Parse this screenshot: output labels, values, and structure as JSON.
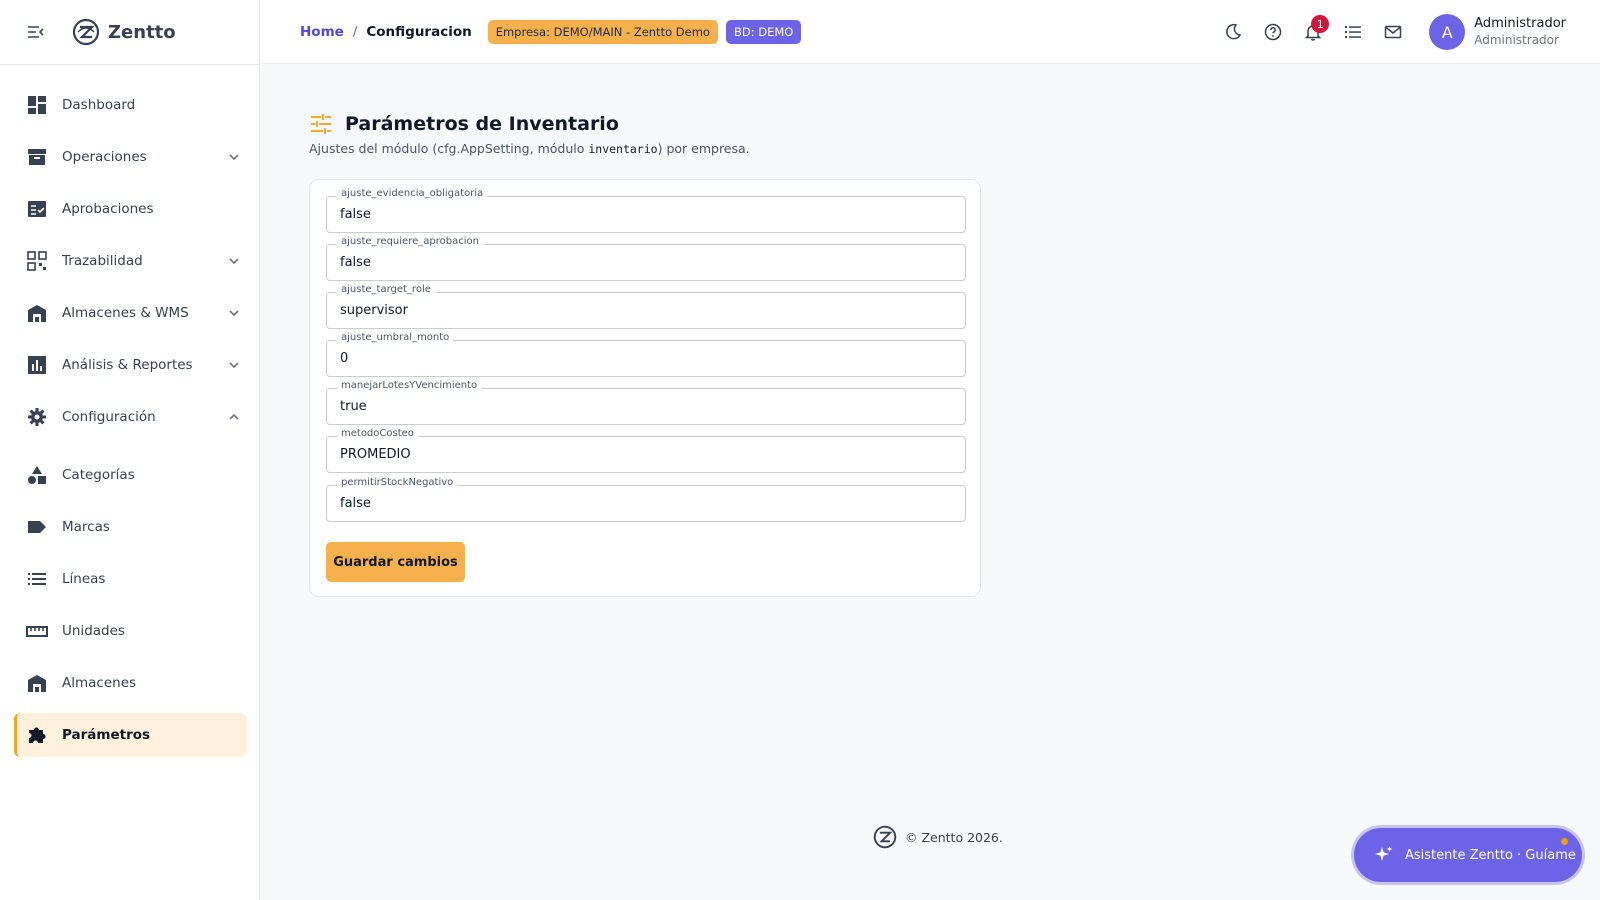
{
  "app": {
    "name": "Zentto"
  },
  "sidebar": {
    "items": [
      {
        "label": "Dashboard",
        "icon": "dashboard-icon"
      },
      {
        "label": "Operaciones",
        "icon": "archive-icon",
        "expandable": true
      },
      {
        "label": "Aprobaciones",
        "icon": "checklist-icon"
      },
      {
        "label": "Trazabilidad",
        "icon": "qr-icon",
        "expandable": true
      },
      {
        "label": "Almacenes & WMS",
        "icon": "warehouse-icon",
        "expandable": true
      },
      {
        "label": "Análisis & Reportes",
        "icon": "chart-icon",
        "expandable": true
      },
      {
        "label": "Configuración",
        "icon": "gear-icon",
        "expandable": true,
        "expanded": true
      },
      {
        "label": "Categorías",
        "icon": "shapes-icon"
      },
      {
        "label": "Marcas",
        "icon": "tag-icon"
      },
      {
        "label": "Líneas",
        "icon": "list-icon"
      },
      {
        "label": "Unidades",
        "icon": "ruler-icon"
      },
      {
        "label": "Almacenes",
        "icon": "warehouse-icon"
      },
      {
        "label": "Parámetros",
        "icon": "puzzle-icon",
        "active": true
      }
    ]
  },
  "header": {
    "breadcrumb": {
      "home": "Home",
      "separator": "/",
      "current": "Configuracion"
    },
    "empresa_chip": "Empresa: DEMO/MAIN - Zentto Demo",
    "bd_chip": "BD: DEMO",
    "notifications_count": "1",
    "user": {
      "initial": "A",
      "name": "Administrador",
      "role": "Administrador"
    }
  },
  "page": {
    "title": "Parámetros de Inventario",
    "subtitle_prefix": "Ajustes del módulo (cfg.AppSetting, módulo ",
    "subtitle_code": "inventario",
    "subtitle_suffix": ") por empresa."
  },
  "fields": [
    {
      "label": "ajuste_evidencia_obligatoria",
      "value": "false"
    },
    {
      "label": "ajuste_requiere_aprobacion",
      "value": "false"
    },
    {
      "label": "ajuste_target_role",
      "value": "supervisor"
    },
    {
      "label": "ajuste_umbral_monto",
      "value": "0"
    },
    {
      "label": "manejarLotesYVencimiento",
      "value": "true"
    },
    {
      "label": "metodoCosteo",
      "value": "PROMEDIO"
    },
    {
      "label": "permitirStockNegativo",
      "value": "false"
    }
  ],
  "actions": {
    "save_label": "Guardar cambios"
  },
  "footer": {
    "text": "© Zentto 2026."
  },
  "assistant": {
    "label": "Asistente Zentto · Guíame"
  },
  "colors": {
    "accent": "#f6b04c",
    "primary": "#6d63e8",
    "link": "#4f46e5",
    "badge": "#d0163a",
    "active_bg": "#fff1dc"
  }
}
